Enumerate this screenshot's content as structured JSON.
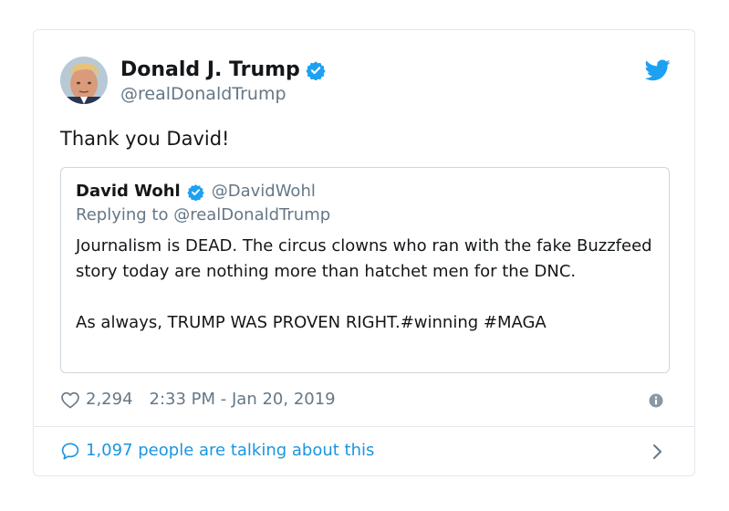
{
  "tweet": {
    "author_name": "Donald J. Trump",
    "author_handle": "@realDonaldTrump",
    "text": "Thank you David!",
    "likes": "2,294",
    "timestamp": "2:33 PM - Jan 20, 2019",
    "conversation": "1,097 people are talking about this",
    "verified": true
  },
  "quote": {
    "author_name": "David Wohl",
    "author_handle": "@DavidWohl",
    "replying_to": "Replying to @realDonaldTrump",
    "paragraph_1": "Journalism is DEAD. The circus clowns who ran with the fake Buzzfeed story today are nothing more than hatchet men for the DNC.",
    "paragraph_2": "As always, TRUMP WAS PROVEN RIGHT.#winning #MAGA",
    "verified": true
  },
  "icons": {
    "brand": "twitter-bird-icon",
    "verified": "verified-badge-icon",
    "like": "heart-icon",
    "info": "info-icon",
    "reply": "speech-bubble-icon",
    "next": "chevron-right-icon"
  },
  "colors": {
    "brand_blue": "#1da1f2",
    "link_blue": "#1b95e0",
    "text_primary": "#14171a",
    "text_secondary": "#657786",
    "border": "#e1e8ed"
  }
}
